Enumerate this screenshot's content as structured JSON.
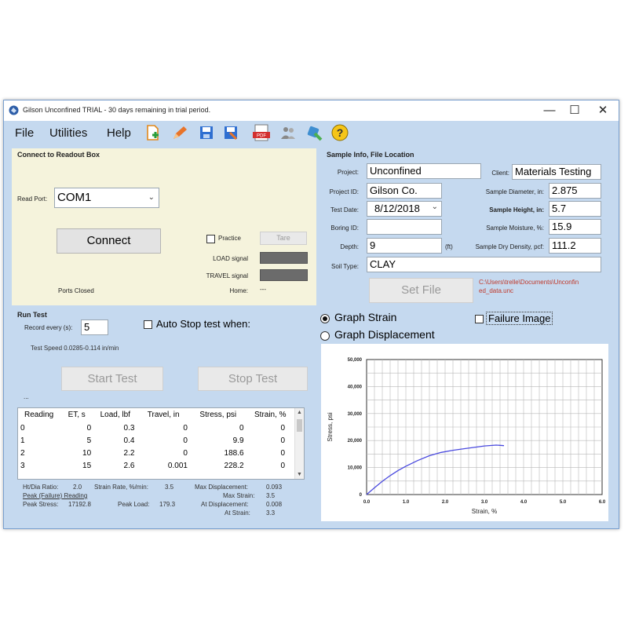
{
  "window": {
    "title": "Gilson Unconfined TRIAL -  30 days remaining in trial period.",
    "controls": {
      "minimize": "—",
      "maximize": "☐",
      "close": "✕"
    }
  },
  "menu": {
    "items": [
      "File",
      "Utilities",
      "Help"
    ]
  },
  "toolbar": {
    "icons": [
      "new-file-icon",
      "pencil-edit-icon",
      "save-icon",
      "save-as-icon",
      "pdf-report-icon",
      "people-icon",
      "tool-icon",
      "help-icon"
    ],
    "help_glyph": "?"
  },
  "colors": {
    "client_bg": "#c5d9ef",
    "panel_bg": "#f5f3dc",
    "plot_line": "#4a4adf",
    "path_text": "#c0392b"
  },
  "connect": {
    "heading": "Connect to Readout Box",
    "read_port_label": "Read Port:",
    "read_port_value": "COM1",
    "connect_button": "Connect",
    "practice_label": "Practice",
    "tare_button": "Tare",
    "load_signal_label": "LOAD signal",
    "travel_signal_label": "TRAVEL signal",
    "home_label": "Home:",
    "home_value": "---",
    "ports_status": "Ports Closed"
  },
  "sample": {
    "heading": "Sample Info, File Location",
    "project_label": "Project:",
    "project_value": "Unconfined",
    "client_label": "Client:",
    "client_value": "Materials Testing",
    "project_id_label": "Project ID:",
    "project_id_value": "Gilson Co.",
    "diameter_label": "Sample Diameter, in:",
    "diameter_value": "2.875",
    "test_date_label": "Test Date:",
    "test_date_value": "8/12/2018",
    "height_label": "Sample Height, in:",
    "height_value": "5.7",
    "boring_id_label": "Boring ID:",
    "boring_id_value": "",
    "moisture_label": "Sample Moisture, %:",
    "moisture_value": "15.9",
    "depth_label": "Depth:",
    "depth_value": "9",
    "depth_unit": "(ft)",
    "density_label": "Sample Dry Density, pcf:",
    "density_value": "111.2",
    "soil_type_label": "Soil Type:",
    "soil_type_value": "CLAY",
    "set_file_button": "Set File",
    "file_path_line1": "C:\\Users\\trelle\\Documents\\Unconfin",
    "file_path_line2": "ed_data.unc"
  },
  "run": {
    "heading": "Run Test",
    "record_every_label": "Record every (s):",
    "record_every_value": "5",
    "auto_stop_label": "Auto Stop test when:",
    "test_speed": "Test Speed 0.0285-0.114 in/min",
    "start_button": "Start Test",
    "stop_button": "Stop Test",
    "status_dots": "..."
  },
  "table": {
    "columns": [
      "Reading",
      "ET, s",
      "Load, lbf",
      "Travel, in",
      "Stress, psi",
      "Strain, %"
    ],
    "rows": [
      [
        "0",
        "0",
        "0.3",
        "0",
        "0",
        "0"
      ],
      [
        "1",
        "5",
        "0.4",
        "0",
        "9.9",
        "0"
      ],
      [
        "2",
        "10",
        "2.2",
        "0",
        "188.6",
        "0"
      ],
      [
        "3",
        "15",
        "2.6",
        "0.001",
        "228.2",
        "0"
      ]
    ]
  },
  "stats": {
    "hdia_label": "Ht/Dia Ratio:",
    "hdia_value": "2.0",
    "strain_rate_label": "Strain Rate, %/min:",
    "strain_rate_value": "3.5",
    "max_disp_label": "Max Displacement:",
    "max_disp_value": "0.093",
    "peak_reading_label": "Peak (Failure) Reading",
    "max_strain_label": "Max Strain:",
    "max_strain_value": "3.5",
    "peak_stress_label": "Peak Stress:",
    "peak_stress_value": "17192.8",
    "peak_load_label": "Peak Load:",
    "peak_load_value": "179.3",
    "at_disp_label": "At Displacement:",
    "at_disp_value": "0.008",
    "at_strain_label": "At Strain:",
    "at_strain_value": "3.3"
  },
  "graph": {
    "graph_strain_label": "Graph Strain",
    "graph_disp_label": "Graph Displacement",
    "failure_image_label": "Failure Image"
  },
  "chart_data": {
    "type": "line",
    "xlabel": "Strain, %",
    "ylabel": "Stress, psi",
    "xlim": [
      0,
      6
    ],
    "ylim": [
      0,
      50000
    ],
    "x_ticks": [
      "0.0",
      "1.0",
      "2.0",
      "3.0",
      "4.0",
      "5.0",
      "6.0"
    ],
    "y_ticks": [
      "0",
      "10,000",
      "20,000",
      "30,000",
      "40,000",
      "50,000"
    ],
    "grid": true,
    "x": [
      0.0,
      0.2,
      0.4,
      0.6,
      0.8,
      1.0,
      1.3,
      1.6,
      1.9,
      2.2,
      2.5,
      2.8,
      3.0,
      3.3,
      3.5
    ],
    "y": [
      0,
      2500,
      4900,
      7000,
      8900,
      10500,
      12600,
      14400,
      15600,
      16400,
      17000,
      17600,
      18000,
      18300,
      18100
    ]
  }
}
